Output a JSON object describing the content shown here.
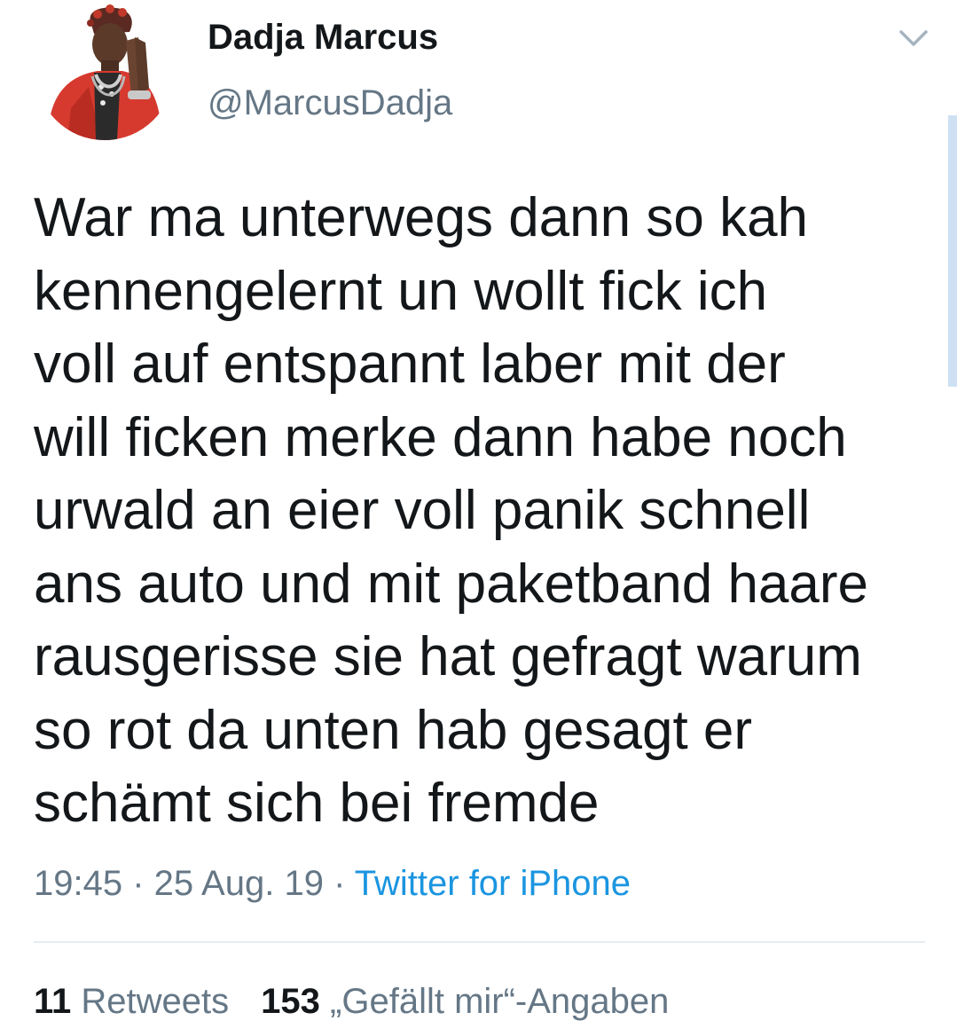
{
  "tweet": {
    "author": {
      "display_name": "Dadja Marcus",
      "handle": "@MarcusDadja",
      "avatar_icon": "profile-photo"
    },
    "text_lines": [
      "War ma unterwegs dann so kah",
      "kennengelernt un wollt fick ich",
      "voll auf entspannt laber mit der",
      "will ficken merke dann habe noch",
      "urwald an eier voll panik schnell",
      "ans auto und mit paketband haare",
      "rausgerisse sie hat gefragt warum",
      "so rot da unten hab gesagt er",
      "schämt sich bei fremde"
    ],
    "meta": {
      "time": "19:45",
      "separator_1": " · ",
      "date": "25 Aug. 19",
      "separator_2": " · ",
      "source": "Twitter for iPhone"
    },
    "stats": {
      "retweets_count": "11",
      "retweets_label": "Retweets",
      "likes_count": "153",
      "likes_label": "„Gefällt mir“-Angaben"
    },
    "menu_icon": "chevron-down-icon",
    "colors": {
      "text": "#14171a",
      "secondary": "#657786",
      "link": "#1b95e0",
      "divider": "#e6ecf0"
    }
  }
}
